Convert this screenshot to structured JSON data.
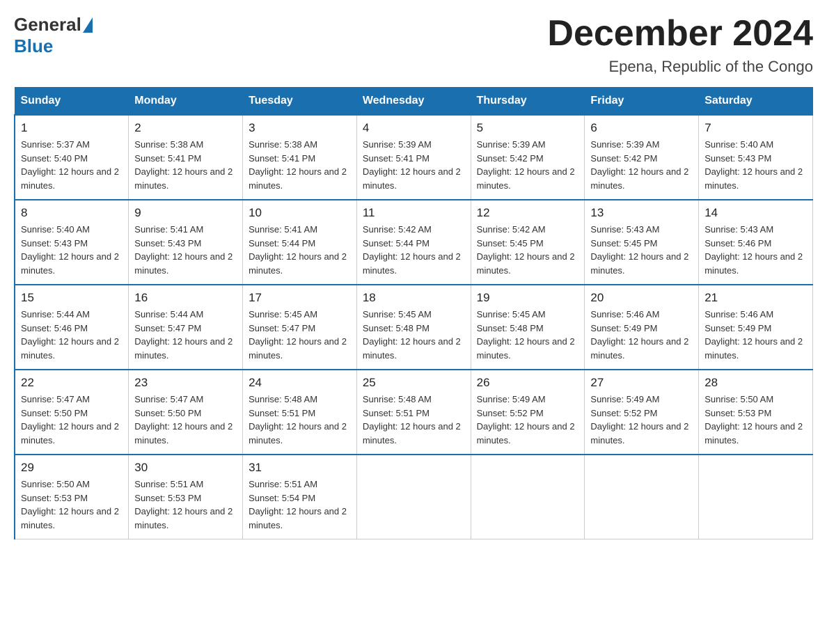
{
  "logo": {
    "general": "General",
    "blue": "Blue"
  },
  "header": {
    "title": "December 2024",
    "subtitle": "Epena, Republic of the Congo"
  },
  "weekdays": [
    "Sunday",
    "Monday",
    "Tuesday",
    "Wednesday",
    "Thursday",
    "Friday",
    "Saturday"
  ],
  "weeks": [
    [
      {
        "day": "1",
        "sunrise": "5:37 AM",
        "sunset": "5:40 PM",
        "daylight": "12 hours and 2 minutes."
      },
      {
        "day": "2",
        "sunrise": "5:38 AM",
        "sunset": "5:41 PM",
        "daylight": "12 hours and 2 minutes."
      },
      {
        "day": "3",
        "sunrise": "5:38 AM",
        "sunset": "5:41 PM",
        "daylight": "12 hours and 2 minutes."
      },
      {
        "day": "4",
        "sunrise": "5:39 AM",
        "sunset": "5:41 PM",
        "daylight": "12 hours and 2 minutes."
      },
      {
        "day": "5",
        "sunrise": "5:39 AM",
        "sunset": "5:42 PM",
        "daylight": "12 hours and 2 minutes."
      },
      {
        "day": "6",
        "sunrise": "5:39 AM",
        "sunset": "5:42 PM",
        "daylight": "12 hours and 2 minutes."
      },
      {
        "day": "7",
        "sunrise": "5:40 AM",
        "sunset": "5:43 PM",
        "daylight": "12 hours and 2 minutes."
      }
    ],
    [
      {
        "day": "8",
        "sunrise": "5:40 AM",
        "sunset": "5:43 PM",
        "daylight": "12 hours and 2 minutes."
      },
      {
        "day": "9",
        "sunrise": "5:41 AM",
        "sunset": "5:43 PM",
        "daylight": "12 hours and 2 minutes."
      },
      {
        "day": "10",
        "sunrise": "5:41 AM",
        "sunset": "5:44 PM",
        "daylight": "12 hours and 2 minutes."
      },
      {
        "day": "11",
        "sunrise": "5:42 AM",
        "sunset": "5:44 PM",
        "daylight": "12 hours and 2 minutes."
      },
      {
        "day": "12",
        "sunrise": "5:42 AM",
        "sunset": "5:45 PM",
        "daylight": "12 hours and 2 minutes."
      },
      {
        "day": "13",
        "sunrise": "5:43 AM",
        "sunset": "5:45 PM",
        "daylight": "12 hours and 2 minutes."
      },
      {
        "day": "14",
        "sunrise": "5:43 AM",
        "sunset": "5:46 PM",
        "daylight": "12 hours and 2 minutes."
      }
    ],
    [
      {
        "day": "15",
        "sunrise": "5:44 AM",
        "sunset": "5:46 PM",
        "daylight": "12 hours and 2 minutes."
      },
      {
        "day": "16",
        "sunrise": "5:44 AM",
        "sunset": "5:47 PM",
        "daylight": "12 hours and 2 minutes."
      },
      {
        "day": "17",
        "sunrise": "5:45 AM",
        "sunset": "5:47 PM",
        "daylight": "12 hours and 2 minutes."
      },
      {
        "day": "18",
        "sunrise": "5:45 AM",
        "sunset": "5:48 PM",
        "daylight": "12 hours and 2 minutes."
      },
      {
        "day": "19",
        "sunrise": "5:45 AM",
        "sunset": "5:48 PM",
        "daylight": "12 hours and 2 minutes."
      },
      {
        "day": "20",
        "sunrise": "5:46 AM",
        "sunset": "5:49 PM",
        "daylight": "12 hours and 2 minutes."
      },
      {
        "day": "21",
        "sunrise": "5:46 AM",
        "sunset": "5:49 PM",
        "daylight": "12 hours and 2 minutes."
      }
    ],
    [
      {
        "day": "22",
        "sunrise": "5:47 AM",
        "sunset": "5:50 PM",
        "daylight": "12 hours and 2 minutes."
      },
      {
        "day": "23",
        "sunrise": "5:47 AM",
        "sunset": "5:50 PM",
        "daylight": "12 hours and 2 minutes."
      },
      {
        "day": "24",
        "sunrise": "5:48 AM",
        "sunset": "5:51 PM",
        "daylight": "12 hours and 2 minutes."
      },
      {
        "day": "25",
        "sunrise": "5:48 AM",
        "sunset": "5:51 PM",
        "daylight": "12 hours and 2 minutes."
      },
      {
        "day": "26",
        "sunrise": "5:49 AM",
        "sunset": "5:52 PM",
        "daylight": "12 hours and 2 minutes."
      },
      {
        "day": "27",
        "sunrise": "5:49 AM",
        "sunset": "5:52 PM",
        "daylight": "12 hours and 2 minutes."
      },
      {
        "day": "28",
        "sunrise": "5:50 AM",
        "sunset": "5:53 PM",
        "daylight": "12 hours and 2 minutes."
      }
    ],
    [
      {
        "day": "29",
        "sunrise": "5:50 AM",
        "sunset": "5:53 PM",
        "daylight": "12 hours and 2 minutes."
      },
      {
        "day": "30",
        "sunrise": "5:51 AM",
        "sunset": "5:53 PM",
        "daylight": "12 hours and 2 minutes."
      },
      {
        "day": "31",
        "sunrise": "5:51 AM",
        "sunset": "5:54 PM",
        "daylight": "12 hours and 2 minutes."
      },
      null,
      null,
      null,
      null
    ]
  ]
}
